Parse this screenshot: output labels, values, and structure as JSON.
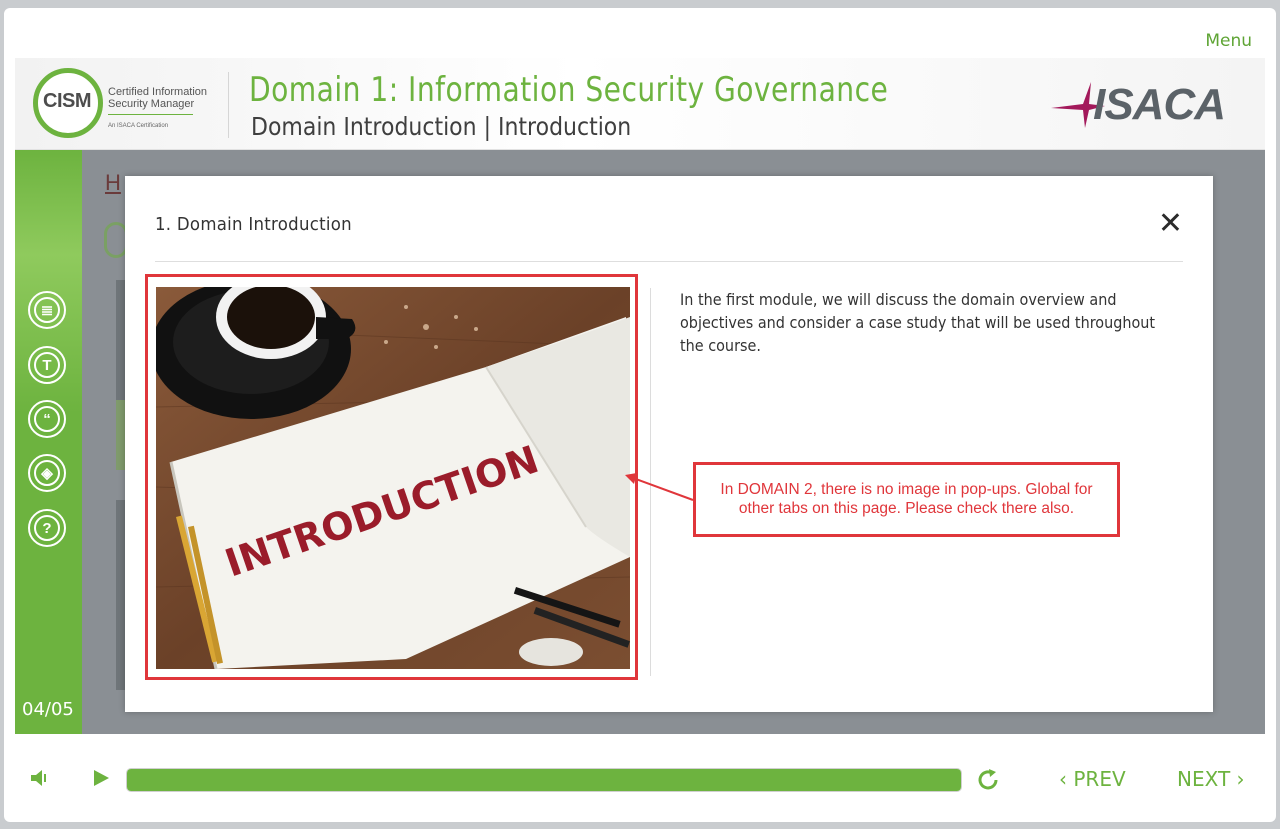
{
  "top": {
    "menu_label": "Menu"
  },
  "header": {
    "logo_text": "CISM",
    "logo_sub_1": "Certified Information",
    "logo_sub_2": "Security Manager",
    "logo_small": "An ISACA Certification",
    "title": "Domain 1: Information Security Governance",
    "subtitle": "Domain Introduction | Introduction",
    "brand": "ISACA"
  },
  "sidebar": {
    "icons": [
      {
        "name": "resources-icon",
        "glyph": "≣"
      },
      {
        "name": "transcript-icon",
        "glyph": "T"
      },
      {
        "name": "quote-icon",
        "glyph": "“"
      },
      {
        "name": "layers-icon",
        "glyph": "◈"
      },
      {
        "name": "help-icon",
        "glyph": "?"
      }
    ],
    "page_count": "04/05"
  },
  "background": {
    "link_text": "H"
  },
  "modal": {
    "title": "1. Domain Introduction",
    "close_glyph": "✕",
    "body": "In the first module, we will discuss the domain overview and objectives and consider a case study that will be used throughout the course.",
    "image_word": "INTRODUCTION",
    "annotation": "In DOMAIN 2, there is no image in pop-ups. Global for other tabs on this page. Please check there also."
  },
  "controls": {
    "progress": 1.0,
    "prev_label": "PREV",
    "next_label": "NEXT"
  },
  "colors": {
    "accent": "#6db33f",
    "annotation": "#e0363b"
  }
}
